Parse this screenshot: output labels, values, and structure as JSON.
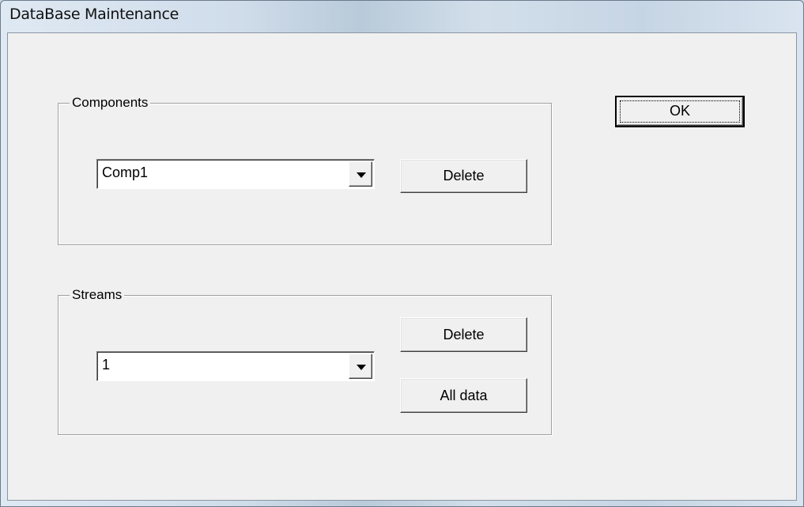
{
  "window": {
    "title": "DataBase Maintenance"
  },
  "ok_button": {
    "label": "OK"
  },
  "components": {
    "group_label": "Components",
    "selected": "Comp1",
    "delete_label": "Delete"
  },
  "streams": {
    "group_label": "Streams",
    "selected": "1",
    "delete_label": "Delete",
    "all_data_label": "All data"
  },
  "icons": {
    "dropdown": "chevron-down-icon"
  }
}
